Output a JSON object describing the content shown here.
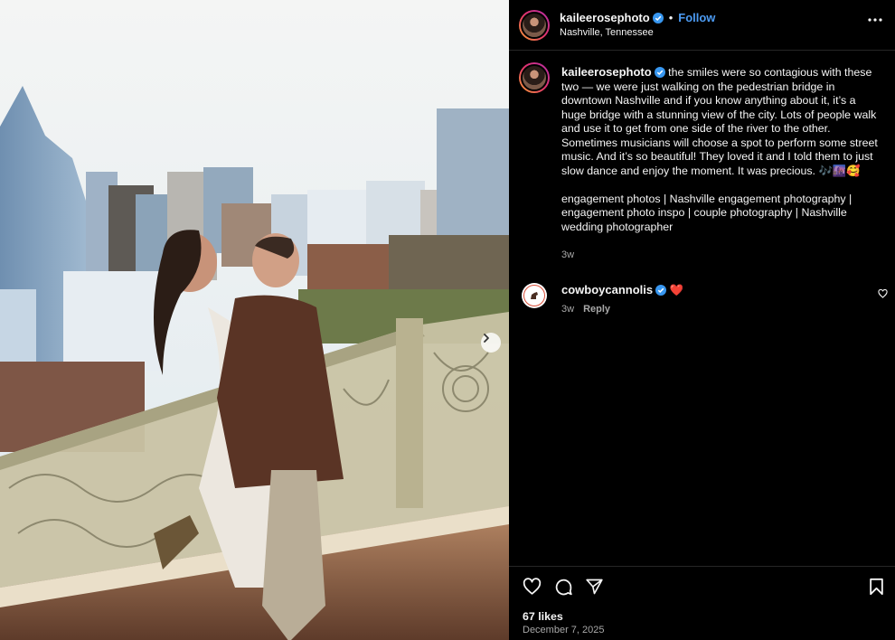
{
  "post": {
    "username": "kaileerosephoto",
    "follow_label": "Follow",
    "separator": "•",
    "location": "Nashville, Tennessee"
  },
  "caption": {
    "username": "kaileerosephoto",
    "text": "the smiles were so contagious with these two — we were just walking on the pedestrian bridge in downtown Nashville and if you know anything about it, it’s a huge bridge with a stunning view of the city. Lots of people walk and use it to get from one side of the river to the other. Sometimes musicians will choose a spot to perform some street music. And it’s so beautiful! They loved it and I told them to just slow dance and enjoy the moment. It was precious. 🎶🌆🥰",
    "hashtags": "engagement photos | Nashville engagement photography | engagement photo inspo | couple photography | Nashville wedding photographer",
    "time": "3w"
  },
  "comment": {
    "username": "cowboycannolis",
    "text": "❤️",
    "time": "3w",
    "reply_label": "Reply"
  },
  "footer": {
    "likes": "67 likes",
    "date": "December 7, 2025"
  },
  "icons": [
    "verified-badge-icon",
    "more-options-icon",
    "chevron-right-icon",
    "heart-icon",
    "comment-icon",
    "share-icon",
    "bookmark-icon"
  ],
  "colors": {
    "background": "#000000",
    "follow": "#4c9bf3",
    "muted": "#a8a8a8",
    "verified": "#3897f0"
  }
}
